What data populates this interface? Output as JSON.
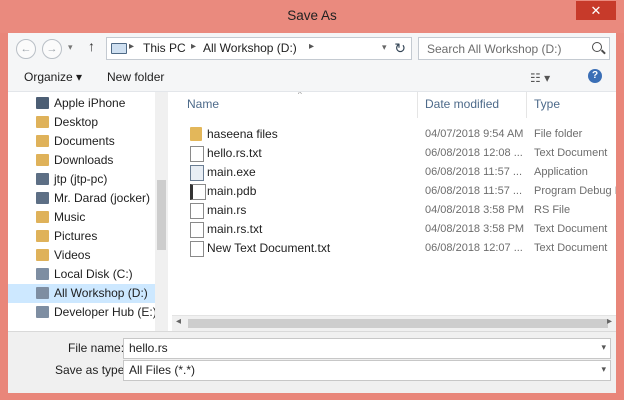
{
  "window": {
    "title": "Save As",
    "close_glyph": "✕"
  },
  "address": {
    "back_glyph": "←",
    "forward_glyph": "→",
    "up_glyph": "↑",
    "crumbs": [
      "This PC",
      "All Workshop (D:)"
    ],
    "sep": "▸",
    "dropdown_glyph": "▾",
    "refresh_glyph": "↻",
    "search_placeholder": "Search All Workshop (D:)"
  },
  "toolbar": {
    "organize": "Organize ▾",
    "new_folder": "New folder",
    "view_glyph": "☷ ▾",
    "help_glyph": "?"
  },
  "nav": [
    {
      "label": "Apple iPhone",
      "icon": "phone-icon",
      "color": "#4c5e74"
    },
    {
      "label": "Desktop",
      "icon": "folder-icon",
      "color": "#dfb25a"
    },
    {
      "label": "Documents",
      "icon": "folder-icon",
      "color": "#dfb25a"
    },
    {
      "label": "Downloads",
      "icon": "folder-icon",
      "color": "#dfb25a"
    },
    {
      "label": "jtp (jtp-pc)",
      "icon": "user-icon",
      "color": "#5d6f85"
    },
    {
      "label": "Mr. Darad (jocker)",
      "icon": "user-icon",
      "color": "#5d6f85"
    },
    {
      "label": "Music",
      "icon": "folder-icon",
      "color": "#dfb25a"
    },
    {
      "label": "Pictures",
      "icon": "folder-icon",
      "color": "#dfb25a"
    },
    {
      "label": "Videos",
      "icon": "folder-icon",
      "color": "#dfb25a"
    },
    {
      "label": "Local Disk (C:)",
      "icon": "drive-icon",
      "color": "#7e8ea2"
    },
    {
      "label": "All Workshop (D:)",
      "icon": "drive-icon",
      "color": "#7e8ea2",
      "selected": true
    },
    {
      "label": "Developer Hub (E:)",
      "icon": "drive-icon",
      "color": "#7e8ea2"
    }
  ],
  "columns": {
    "name": "Name",
    "date": "Date modified",
    "type": "Type",
    "sort_glyph": "^"
  },
  "files": [
    {
      "name": "haseena files",
      "date": "04/07/2018 9:54 AM",
      "type": "File folder",
      "icon": "folder-icon"
    },
    {
      "name": "hello.rs.txt",
      "date": "06/08/2018 12:08 ...",
      "type": "Text Document",
      "icon": "text-file-icon"
    },
    {
      "name": "main.exe",
      "date": "06/08/2018 11:57 ...",
      "type": "Application",
      "icon": "application-icon"
    },
    {
      "name": "main.pdb",
      "date": "06/08/2018 11:57 ...",
      "type": "Program Debug D...",
      "icon": "debug-file-icon"
    },
    {
      "name": "main.rs",
      "date": "04/08/2018 3:58 PM",
      "type": "RS File",
      "icon": "file-icon"
    },
    {
      "name": "main.rs.txt",
      "date": "04/08/2018 3:58 PM",
      "type": "Text Document",
      "icon": "text-file-icon"
    },
    {
      "name": "New Text Document.txt",
      "date": "06/08/2018 12:07 ...",
      "type": "Text Document",
      "icon": "text-file-icon"
    }
  ],
  "scroll_arrows": {
    "left": "◂",
    "right": "▸"
  },
  "form": {
    "filename_label": "File name:",
    "filename_value": "hello.rs",
    "type_label": "Save as type:",
    "type_value": "All Files  (*.*)",
    "dropdown_glyph": "▾"
  }
}
